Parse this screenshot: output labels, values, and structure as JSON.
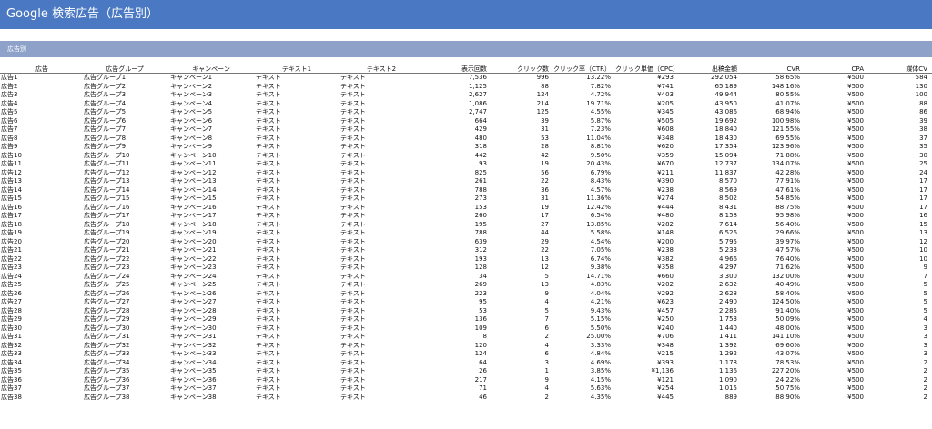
{
  "header": {
    "title": "Google 検索広告（広告別）"
  },
  "section": {
    "title": "広告別"
  },
  "table": {
    "columns": [
      "広告",
      "広告グループ",
      "キャンペーン",
      "テキスト1",
      "テキスト2",
      "表示回数",
      "クリック数",
      "クリック率（CTR）",
      "クリック単価（CPC）",
      "出稿金額",
      "CVR",
      "CPA",
      "媒体CV"
    ],
    "rows": [
      [
        "広告1",
        "広告グループ1",
        "キャンペーン1",
        "テキスト",
        "テキスト",
        "7,536",
        "996",
        "13.22%",
        "¥293",
        "292,054",
        "58.65%",
        "¥500",
        "584"
      ],
      [
        "広告2",
        "広告グループ2",
        "キャンペーン2",
        "テキスト",
        "テキスト",
        "1,125",
        "88",
        "7.82%",
        "¥741",
        "65,189",
        "148.16%",
        "¥500",
        "130"
      ],
      [
        "広告3",
        "広告グループ3",
        "キャンペーン3",
        "テキスト",
        "テキスト",
        "2,627",
        "124",
        "4.72%",
        "¥403",
        "49,944",
        "80.55%",
        "¥500",
        "100"
      ],
      [
        "広告4",
        "広告グループ4",
        "キャンペーン4",
        "テキスト",
        "テキスト",
        "1,086",
        "214",
        "19.71%",
        "¥205",
        "43,950",
        "41.07%",
        "¥500",
        "88"
      ],
      [
        "広告5",
        "広告グループ5",
        "キャンペーン5",
        "テキスト",
        "テキスト",
        "2,747",
        "125",
        "4.55%",
        "¥345",
        "43,086",
        "68.94%",
        "¥500",
        "86"
      ],
      [
        "広告6",
        "広告グループ6",
        "キャンペーン6",
        "テキスト",
        "テキスト",
        "664",
        "39",
        "5.87%",
        "¥505",
        "19,692",
        "100.98%",
        "¥500",
        "39"
      ],
      [
        "広告7",
        "広告グループ7",
        "キャンペーン7",
        "テキスト",
        "テキスト",
        "429",
        "31",
        "7.23%",
        "¥608",
        "18,840",
        "121.55%",
        "¥500",
        "38"
      ],
      [
        "広告8",
        "広告グループ8",
        "キャンペーン8",
        "テキスト",
        "テキスト",
        "480",
        "53",
        "11.04%",
        "¥348",
        "18,430",
        "69.55%",
        "¥500",
        "37"
      ],
      [
        "広告9",
        "広告グループ9",
        "キャンペーン9",
        "テキスト",
        "テキスト",
        "318",
        "28",
        "8.81%",
        "¥620",
        "17,354",
        "123.96%",
        "¥500",
        "35"
      ],
      [
        "広告10",
        "広告グループ10",
        "キャンペーン10",
        "テキスト",
        "テキスト",
        "442",
        "42",
        "9.50%",
        "¥359",
        "15,094",
        "71.88%",
        "¥500",
        "30"
      ],
      [
        "広告11",
        "広告グループ11",
        "キャンペーン11",
        "テキスト",
        "テキスト",
        "93",
        "19",
        "20.43%",
        "¥670",
        "12,737",
        "134.07%",
        "¥500",
        "25"
      ],
      [
        "広告12",
        "広告グループ12",
        "キャンペーン12",
        "テキスト",
        "テキスト",
        "825",
        "56",
        "6.79%",
        "¥211",
        "11,837",
        "42.28%",
        "¥500",
        "24"
      ],
      [
        "広告13",
        "広告グループ13",
        "キャンペーン13",
        "テキスト",
        "テキスト",
        "261",
        "22",
        "8.43%",
        "¥390",
        "8,570",
        "77.91%",
        "¥500",
        "17"
      ],
      [
        "広告14",
        "広告グループ14",
        "キャンペーン14",
        "テキスト",
        "テキスト",
        "788",
        "36",
        "4.57%",
        "¥238",
        "8,569",
        "47.61%",
        "¥500",
        "17"
      ],
      [
        "広告15",
        "広告グループ15",
        "キャンペーン15",
        "テキスト",
        "テキスト",
        "273",
        "31",
        "11.36%",
        "¥274",
        "8,502",
        "54.85%",
        "¥500",
        "17"
      ],
      [
        "広告16",
        "広告グループ16",
        "キャンペーン16",
        "テキスト",
        "テキスト",
        "153",
        "19",
        "12.42%",
        "¥444",
        "8,431",
        "88.75%",
        "¥500",
        "17"
      ],
      [
        "広告17",
        "広告グループ17",
        "キャンペーン17",
        "テキスト",
        "テキスト",
        "260",
        "17",
        "6.54%",
        "¥480",
        "8,158",
        "95.98%",
        "¥500",
        "16"
      ],
      [
        "広告18",
        "広告グループ18",
        "キャンペーン18",
        "テキスト",
        "テキスト",
        "195",
        "27",
        "13.85%",
        "¥282",
        "7,614",
        "56.40%",
        "¥500",
        "15"
      ],
      [
        "広告19",
        "広告グループ19",
        "キャンペーン19",
        "テキスト",
        "テキスト",
        "788",
        "44",
        "5.58%",
        "¥148",
        "6,526",
        "29.66%",
        "¥500",
        "13"
      ],
      [
        "広告20",
        "広告グループ20",
        "キャンペーン20",
        "テキスト",
        "テキスト",
        "639",
        "29",
        "4.54%",
        "¥200",
        "5,795",
        "39.97%",
        "¥500",
        "12"
      ],
      [
        "広告21",
        "広告グループ21",
        "キャンペーン21",
        "テキスト",
        "テキスト",
        "312",
        "22",
        "7.05%",
        "¥238",
        "5,233",
        "47.57%",
        "¥500",
        "10"
      ],
      [
        "広告22",
        "広告グループ22",
        "キャンペーン22",
        "テキスト",
        "テキスト",
        "193",
        "13",
        "6.74%",
        "¥382",
        "4,966",
        "76.40%",
        "¥500",
        "10"
      ],
      [
        "広告23",
        "広告グループ23",
        "キャンペーン23",
        "テキスト",
        "テキスト",
        "128",
        "12",
        "9.38%",
        "¥358",
        "4,297",
        "71.62%",
        "¥500",
        "9"
      ],
      [
        "広告24",
        "広告グループ24",
        "キャンペーン24",
        "テキスト",
        "テキスト",
        "34",
        "5",
        "14.71%",
        "¥660",
        "3,300",
        "132.00%",
        "¥500",
        "7"
      ],
      [
        "広告25",
        "広告グループ25",
        "キャンペーン25",
        "テキスト",
        "テキスト",
        "269",
        "13",
        "4.83%",
        "¥202",
        "2,632",
        "40.49%",
        "¥500",
        "5"
      ],
      [
        "広告26",
        "広告グループ26",
        "キャンペーン26",
        "テキスト",
        "テキスト",
        "223",
        "9",
        "4.04%",
        "¥292",
        "2,628",
        "58.40%",
        "¥500",
        "5"
      ],
      [
        "広告27",
        "広告グループ27",
        "キャンペーン27",
        "テキスト",
        "テキスト",
        "95",
        "4",
        "4.21%",
        "¥623",
        "2,490",
        "124.50%",
        "¥500",
        "5"
      ],
      [
        "広告28",
        "広告グループ28",
        "キャンペーン28",
        "テキスト",
        "テキスト",
        "53",
        "5",
        "9.43%",
        "¥457",
        "2,285",
        "91.40%",
        "¥500",
        "5"
      ],
      [
        "広告29",
        "広告グループ29",
        "キャンペーン29",
        "テキスト",
        "テキスト",
        "136",
        "7",
        "5.15%",
        "¥250",
        "1,753",
        "50.09%",
        "¥500",
        "4"
      ],
      [
        "広告30",
        "広告グループ30",
        "キャンペーン30",
        "テキスト",
        "テキスト",
        "109",
        "6",
        "5.50%",
        "¥240",
        "1,440",
        "48.00%",
        "¥500",
        "3"
      ],
      [
        "広告31",
        "広告グループ31",
        "キャンペーン31",
        "テキスト",
        "テキスト",
        "8",
        "2",
        "25.00%",
        "¥706",
        "1,411",
        "141.10%",
        "¥500",
        "3"
      ],
      [
        "広告32",
        "広告グループ32",
        "キャンペーン32",
        "テキスト",
        "テキスト",
        "120",
        "4",
        "3.33%",
        "¥348",
        "1,392",
        "69.60%",
        "¥500",
        "3"
      ],
      [
        "広告33",
        "広告グループ33",
        "キャンペーン33",
        "テキスト",
        "テキスト",
        "124",
        "6",
        "4.84%",
        "¥215",
        "1,292",
        "43.07%",
        "¥500",
        "3"
      ],
      [
        "広告34",
        "広告グループ34",
        "キャンペーン34",
        "テキスト",
        "テキスト",
        "64",
        "3",
        "4.69%",
        "¥393",
        "1,178",
        "78.53%",
        "¥500",
        "2"
      ],
      [
        "広告35",
        "広告グループ35",
        "キャンペーン35",
        "テキスト",
        "テキスト",
        "26",
        "1",
        "3.85%",
        "¥1,136",
        "1,136",
        "227.20%",
        "¥500",
        "2"
      ],
      [
        "広告36",
        "広告グループ36",
        "キャンペーン36",
        "テキスト",
        "テキスト",
        "217",
        "9",
        "4.15%",
        "¥121",
        "1,090",
        "24.22%",
        "¥500",
        "2"
      ],
      [
        "広告37",
        "広告グループ37",
        "キャンペーン37",
        "テキスト",
        "テキスト",
        "71",
        "4",
        "5.63%",
        "¥254",
        "1,015",
        "50.75%",
        "¥500",
        "2"
      ],
      [
        "広告38",
        "広告グループ38",
        "キャンペーン38",
        "テキスト",
        "テキスト",
        "46",
        "2",
        "4.35%",
        "¥445",
        "889",
        "88.90%",
        "¥500",
        "2"
      ]
    ]
  }
}
